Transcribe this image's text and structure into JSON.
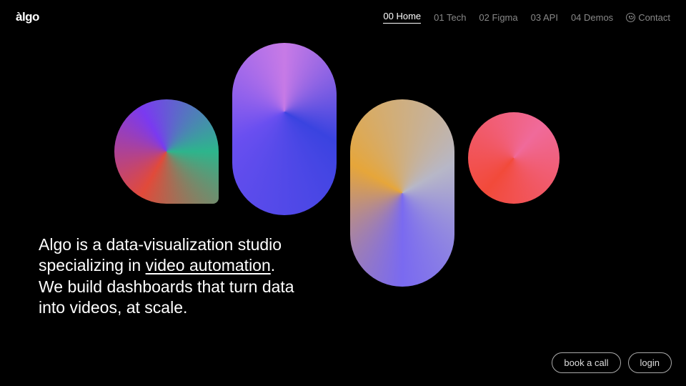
{
  "logo": "àlgo",
  "nav": {
    "items": [
      {
        "label": "00 Home",
        "active": true
      },
      {
        "label": "01 Tech",
        "active": false
      },
      {
        "label": "02 Figma",
        "active": false
      },
      {
        "label": "03 API",
        "active": false
      },
      {
        "label": "04 Demos",
        "active": false
      }
    ],
    "contact_label": "Contact"
  },
  "tagline": {
    "line1": "Algo is a data-visualization studio",
    "line2_pre": "specializing in ",
    "line2_underlined": "video automation",
    "line2_post": ".",
    "line3": "We build dashboards that turn data",
    "line4": "into videos, at scale."
  },
  "cta": {
    "book": "book a call",
    "login": "login"
  }
}
